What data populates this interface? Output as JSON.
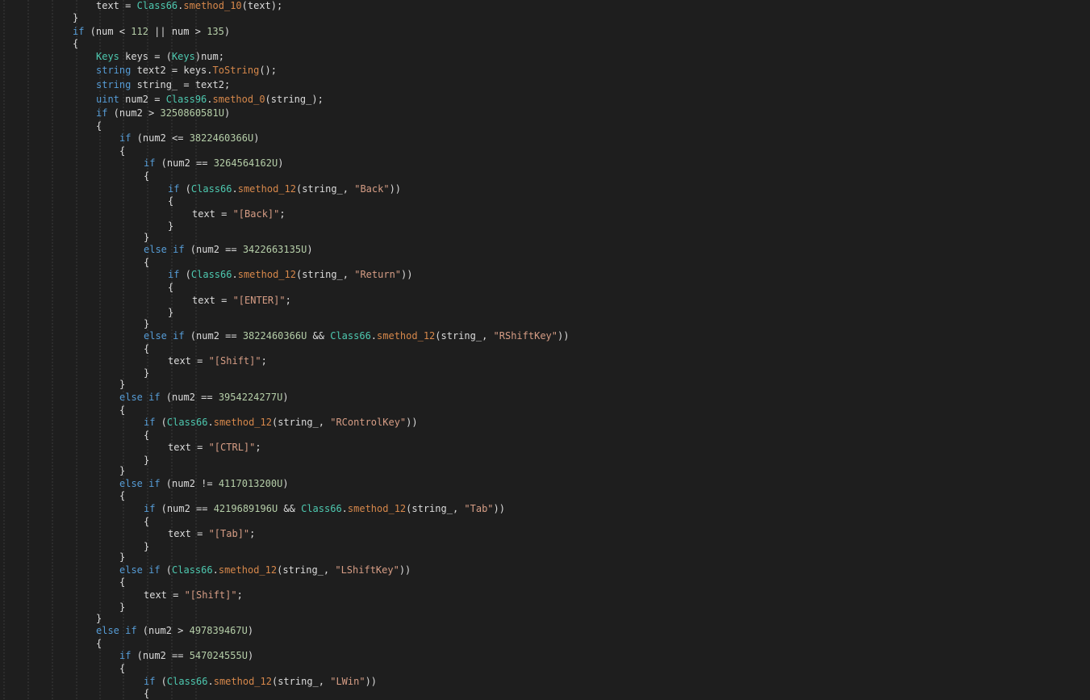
{
  "editor": {
    "colors": {
      "background": "#1e1e1e",
      "plain": "#dcdcdc",
      "keyword": "#569cd6",
      "class": "#4ec9b0",
      "method": "#d7884b",
      "number": "#b5cea8",
      "string": "#d69d85",
      "indent_guide": "#3a3a3a"
    },
    "lines": [
      {
        "indent": 4,
        "tokens": [
          [
            "pl",
            "text = "
          ],
          [
            "cls",
            "Class66"
          ],
          [
            "pl",
            "."
          ],
          [
            "fn",
            "smethod_10"
          ],
          [
            "pl",
            "(text);"
          ]
        ]
      },
      {
        "indent": 3,
        "tokens": [
          [
            "pl",
            "}"
          ]
        ]
      },
      {
        "indent": 3,
        "tokens": [
          [
            "kw",
            "if"
          ],
          [
            "pl",
            " (num < "
          ],
          [
            "num",
            "112"
          ],
          [
            "pl",
            " || num > "
          ],
          [
            "num",
            "135"
          ],
          [
            "pl",
            ")"
          ]
        ]
      },
      {
        "indent": 3,
        "tokens": [
          [
            "pl",
            "{"
          ]
        ]
      },
      {
        "indent": 4,
        "tokens": [
          [
            "cls",
            "Keys"
          ],
          [
            "pl",
            " keys = ("
          ],
          [
            "cls",
            "Keys"
          ],
          [
            "pl",
            ")num;"
          ]
        ]
      },
      {
        "indent": 4,
        "tokens": [
          [
            "kw",
            "string"
          ],
          [
            "pl",
            " text2 = keys."
          ],
          [
            "fn",
            "ToString"
          ],
          [
            "pl",
            "();"
          ]
        ]
      },
      {
        "indent": 4,
        "tokens": [
          [
            "kw",
            "string"
          ],
          [
            "pl",
            " string_ = text2;"
          ]
        ]
      },
      {
        "indent": 4,
        "tokens": [
          [
            "kw",
            "uint"
          ],
          [
            "pl",
            " num2 = "
          ],
          [
            "cls",
            "Class96"
          ],
          [
            "pl",
            "."
          ],
          [
            "fn",
            "smethod_0"
          ],
          [
            "pl",
            "(string_);"
          ]
        ]
      },
      {
        "indent": 4,
        "tokens": [
          [
            "kw",
            "if"
          ],
          [
            "pl",
            " (num2 > "
          ],
          [
            "num",
            "3250860581U"
          ],
          [
            "pl",
            ")"
          ]
        ]
      },
      {
        "indent": 4,
        "tokens": [
          [
            "pl",
            "{"
          ]
        ]
      },
      {
        "indent": 5,
        "tokens": [
          [
            "kw",
            "if"
          ],
          [
            "pl",
            " (num2 <= "
          ],
          [
            "num",
            "3822460366U"
          ],
          [
            "pl",
            ")"
          ]
        ]
      },
      {
        "indent": 5,
        "tokens": [
          [
            "pl",
            "{"
          ]
        ]
      },
      {
        "indent": 6,
        "tokens": [
          [
            "kw",
            "if"
          ],
          [
            "pl",
            " (num2 == "
          ],
          [
            "num",
            "3264564162U"
          ],
          [
            "pl",
            ")"
          ]
        ]
      },
      {
        "indent": 6,
        "tokens": [
          [
            "pl",
            "{"
          ]
        ]
      },
      {
        "indent": 7,
        "tokens": [
          [
            "kw",
            "if"
          ],
          [
            "pl",
            " ("
          ],
          [
            "cls",
            "Class66"
          ],
          [
            "pl",
            "."
          ],
          [
            "fn",
            "smethod_12"
          ],
          [
            "pl",
            "(string_, "
          ],
          [
            "str",
            "\"Back\""
          ],
          [
            "pl",
            "))"
          ]
        ]
      },
      {
        "indent": 7,
        "tokens": [
          [
            "pl",
            "{"
          ]
        ]
      },
      {
        "indent": 8,
        "tokens": [
          [
            "pl",
            "text = "
          ],
          [
            "str",
            "\"[Back]\""
          ],
          [
            "pl",
            ";"
          ]
        ]
      },
      {
        "indent": 7,
        "tokens": [
          [
            "pl",
            "}"
          ]
        ]
      },
      {
        "indent": 6,
        "tokens": [
          [
            "pl",
            "}"
          ]
        ]
      },
      {
        "indent": 6,
        "tokens": [
          [
            "kw",
            "else if"
          ],
          [
            "pl",
            " (num2 == "
          ],
          [
            "num",
            "3422663135U"
          ],
          [
            "pl",
            ")"
          ]
        ]
      },
      {
        "indent": 6,
        "tokens": [
          [
            "pl",
            "{"
          ]
        ]
      },
      {
        "indent": 7,
        "tokens": [
          [
            "kw",
            "if"
          ],
          [
            "pl",
            " ("
          ],
          [
            "cls",
            "Class66"
          ],
          [
            "pl",
            "."
          ],
          [
            "fn",
            "smethod_12"
          ],
          [
            "pl",
            "(string_, "
          ],
          [
            "str",
            "\"Return\""
          ],
          [
            "pl",
            "))"
          ]
        ]
      },
      {
        "indent": 7,
        "tokens": [
          [
            "pl",
            "{"
          ]
        ]
      },
      {
        "indent": 8,
        "tokens": [
          [
            "pl",
            "text = "
          ],
          [
            "str",
            "\"[ENTER]\""
          ],
          [
            "pl",
            ";"
          ]
        ]
      },
      {
        "indent": 7,
        "tokens": [
          [
            "pl",
            "}"
          ]
        ]
      },
      {
        "indent": 6,
        "tokens": [
          [
            "pl",
            "}"
          ]
        ]
      },
      {
        "indent": 6,
        "tokens": [
          [
            "kw",
            "else if"
          ],
          [
            "pl",
            " (num2 == "
          ],
          [
            "num",
            "3822460366U"
          ],
          [
            "pl",
            " && "
          ],
          [
            "cls",
            "Class66"
          ],
          [
            "pl",
            "."
          ],
          [
            "fn",
            "smethod_12"
          ],
          [
            "pl",
            "(string_, "
          ],
          [
            "str",
            "\"RShiftKey\""
          ],
          [
            "pl",
            "))"
          ]
        ]
      },
      {
        "indent": 6,
        "tokens": [
          [
            "pl",
            "{"
          ]
        ]
      },
      {
        "indent": 7,
        "tokens": [
          [
            "pl",
            "text = "
          ],
          [
            "str",
            "\"[Shift]\""
          ],
          [
            "pl",
            ";"
          ]
        ]
      },
      {
        "indent": 6,
        "tokens": [
          [
            "pl",
            "}"
          ]
        ]
      },
      {
        "indent": 5,
        "tokens": [
          [
            "pl",
            "}"
          ]
        ]
      },
      {
        "indent": 5,
        "tokens": [
          [
            "kw",
            "else if"
          ],
          [
            "pl",
            " (num2 == "
          ],
          [
            "num",
            "3954224277U"
          ],
          [
            "pl",
            ")"
          ]
        ]
      },
      {
        "indent": 5,
        "tokens": [
          [
            "pl",
            "{"
          ]
        ]
      },
      {
        "indent": 6,
        "tokens": [
          [
            "kw",
            "if"
          ],
          [
            "pl",
            " ("
          ],
          [
            "cls",
            "Class66"
          ],
          [
            "pl",
            "."
          ],
          [
            "fn",
            "smethod_12"
          ],
          [
            "pl",
            "(string_, "
          ],
          [
            "str",
            "\"RControlKey\""
          ],
          [
            "pl",
            "))"
          ]
        ]
      },
      {
        "indent": 6,
        "tokens": [
          [
            "pl",
            "{"
          ]
        ]
      },
      {
        "indent": 7,
        "tokens": [
          [
            "pl",
            "text = "
          ],
          [
            "str",
            "\"[CTRL]\""
          ],
          [
            "pl",
            ";"
          ]
        ]
      },
      {
        "indent": 6,
        "tokens": [
          [
            "pl",
            "}"
          ]
        ]
      },
      {
        "indent": 5,
        "tokens": [
          [
            "pl",
            "}"
          ]
        ]
      },
      {
        "indent": 5,
        "tokens": [
          [
            "kw",
            "else if"
          ],
          [
            "pl",
            " (num2 != "
          ],
          [
            "num",
            "4117013200U"
          ],
          [
            "pl",
            ")"
          ]
        ]
      },
      {
        "indent": 5,
        "tokens": [
          [
            "pl",
            "{"
          ]
        ]
      },
      {
        "indent": 6,
        "tokens": [
          [
            "kw",
            "if"
          ],
          [
            "pl",
            " (num2 == "
          ],
          [
            "num",
            "4219689196U"
          ],
          [
            "pl",
            " && "
          ],
          [
            "cls",
            "Class66"
          ],
          [
            "pl",
            "."
          ],
          [
            "fn",
            "smethod_12"
          ],
          [
            "pl",
            "(string_, "
          ],
          [
            "str",
            "\"Tab\""
          ],
          [
            "pl",
            "))"
          ]
        ]
      },
      {
        "indent": 6,
        "tokens": [
          [
            "pl",
            "{"
          ]
        ]
      },
      {
        "indent": 7,
        "tokens": [
          [
            "pl",
            "text = "
          ],
          [
            "str",
            "\"[Tab]\""
          ],
          [
            "pl",
            ";"
          ]
        ]
      },
      {
        "indent": 6,
        "tokens": [
          [
            "pl",
            "}"
          ]
        ]
      },
      {
        "indent": 5,
        "tokens": [
          [
            "pl",
            "}"
          ]
        ]
      },
      {
        "indent": 5,
        "tokens": [
          [
            "kw",
            "else if"
          ],
          [
            "pl",
            " ("
          ],
          [
            "cls",
            "Class66"
          ],
          [
            "pl",
            "."
          ],
          [
            "fn",
            "smethod_12"
          ],
          [
            "pl",
            "(string_, "
          ],
          [
            "str",
            "\"LShiftKey\""
          ],
          [
            "pl",
            "))"
          ]
        ]
      },
      {
        "indent": 5,
        "tokens": [
          [
            "pl",
            "{"
          ]
        ]
      },
      {
        "indent": 6,
        "tokens": [
          [
            "pl",
            "text = "
          ],
          [
            "str",
            "\"[Shift]\""
          ],
          [
            "pl",
            ";"
          ]
        ]
      },
      {
        "indent": 5,
        "tokens": [
          [
            "pl",
            "}"
          ]
        ]
      },
      {
        "indent": 4,
        "tokens": [
          [
            "pl",
            "}"
          ]
        ]
      },
      {
        "indent": 4,
        "tokens": [
          [
            "kw",
            "else if"
          ],
          [
            "pl",
            " (num2 > "
          ],
          [
            "num",
            "497839467U"
          ],
          [
            "pl",
            ")"
          ]
        ]
      },
      {
        "indent": 4,
        "tokens": [
          [
            "pl",
            "{"
          ]
        ]
      },
      {
        "indent": 5,
        "tokens": [
          [
            "kw",
            "if"
          ],
          [
            "pl",
            " (num2 == "
          ],
          [
            "num",
            "547024555U"
          ],
          [
            "pl",
            ")"
          ]
        ]
      },
      {
        "indent": 5,
        "tokens": [
          [
            "pl",
            "{"
          ]
        ]
      },
      {
        "indent": 6,
        "tokens": [
          [
            "kw",
            "if"
          ],
          [
            "pl",
            " ("
          ],
          [
            "cls",
            "Class66"
          ],
          [
            "pl",
            "."
          ],
          [
            "fn",
            "smethod_12"
          ],
          [
            "pl",
            "(string_, "
          ],
          [
            "str",
            "\"LWin\""
          ],
          [
            "pl",
            "))"
          ]
        ]
      },
      {
        "indent": 6,
        "tokens": [
          [
            "pl",
            "{"
          ]
        ]
      }
    ]
  }
}
